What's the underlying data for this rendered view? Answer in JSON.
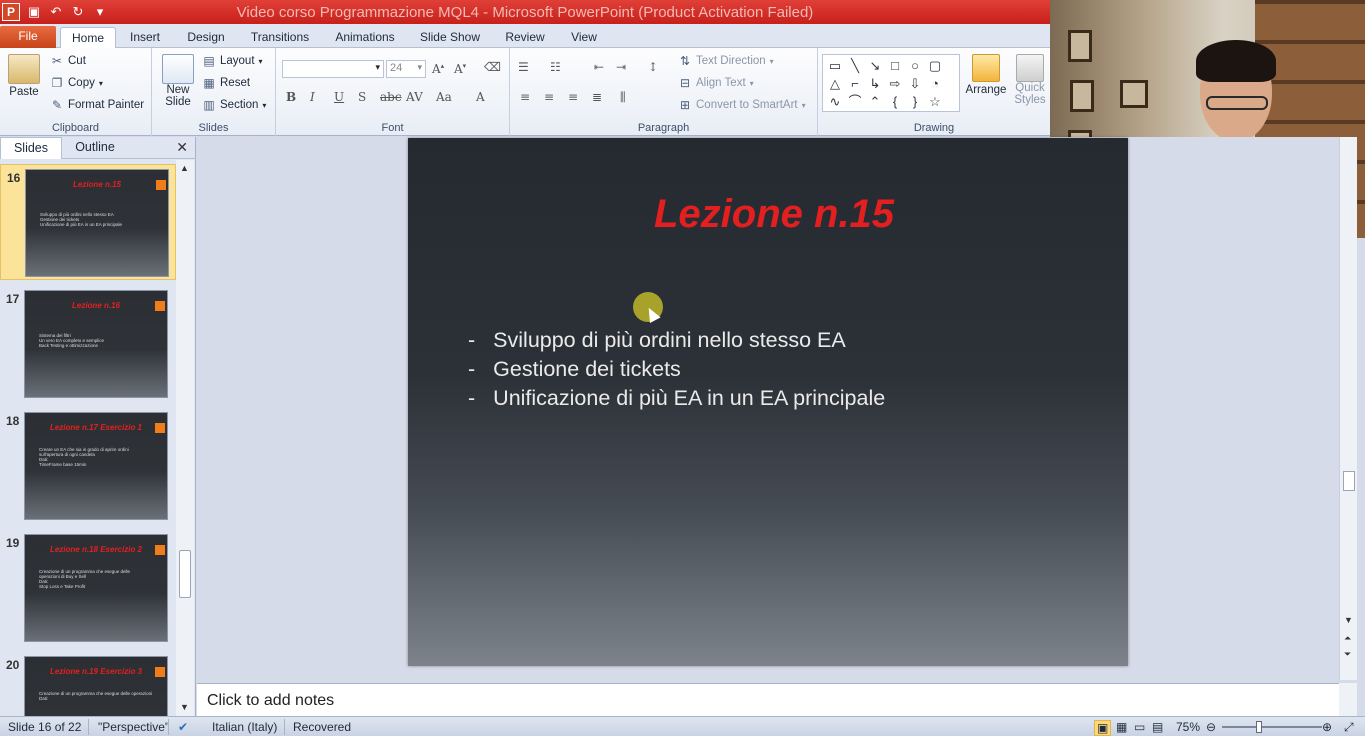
{
  "window": {
    "title": "Video corso Programmazione MQL4  -  Microsoft PowerPoint (Product Activation Failed)"
  },
  "tabs": [
    "File",
    "Home",
    "Insert",
    "Design",
    "Transitions",
    "Animations",
    "Slide Show",
    "Review",
    "View"
  ],
  "ribbon": {
    "clipboard": {
      "paste": "Paste",
      "cut": "Cut",
      "copy": "Copy",
      "format_painter": "Format Painter",
      "label": "Clipboard"
    },
    "slides": {
      "new_slide_1": "New",
      "new_slide_2": "Slide",
      "layout": "Layout",
      "reset": "Reset",
      "section": "Section",
      "label": "Slides"
    },
    "font": {
      "name": "",
      "size": "24",
      "label": "Font"
    },
    "paragraph": {
      "text_direction": "Text Direction",
      "align_text": "Align Text",
      "convert_smartart": "Convert to SmartArt",
      "label": "Paragraph"
    },
    "drawing": {
      "arrange": "Arrange",
      "quick_styles_1": "Quick",
      "quick_styles_2": "Styles",
      "label": "Drawing"
    }
  },
  "left_panel": {
    "tab_slides": "Slides",
    "tab_outline": "Outline",
    "thumbnails": [
      {
        "num": "16",
        "title": "Lezione n.15",
        "bullets": [
          "Sviluppo di più ordini nello stesso EA",
          "Gestione dei tickets",
          "Unificazione di più EA in un EA principale"
        ],
        "selected": true
      },
      {
        "num": "17",
        "title": "Lezione n.16",
        "bullets": [
          "Sistema dei filtri",
          "Un vero EA completo e semplice",
          "Back Testing e ottimizzazione"
        ],
        "selected": false
      },
      {
        "num": "18",
        "title": "Lezione n.17 Esercizio 1",
        "bullets": [
          "Creare un EA che sia in grado di aprire ordini",
          "sull'apertura di ogni candela",
          "Dati:",
          "TimeFrame base 15min"
        ],
        "selected": false
      },
      {
        "num": "19",
        "title": "Lezione n.18 Esercizio 2",
        "bullets": [
          "Creazione di un programma che esegue delle",
          "operazioni di Buy e Sell",
          "Dati:",
          "Stop Loss e Take Profit"
        ],
        "selected": false
      },
      {
        "num": "20",
        "title": "Lezione n.19 Esercizio 3",
        "bullets": [
          "Creazione di un programma che esegue delle operazioni",
          "Dati:"
        ],
        "selected": false
      }
    ]
  },
  "slide": {
    "title": "Lezione n.15",
    "bullets": [
      "Sviluppo di più ordini nello stesso EA",
      "Gestione dei tickets",
      "Unificazione di più EA in un EA principale"
    ]
  },
  "notes": {
    "placeholder": "Click to add notes"
  },
  "status": {
    "slide_info": "Slide 16 of 22",
    "theme": "\"Perspective\"",
    "language": "Italian (Italy)",
    "recovered": "Recovered",
    "zoom": "75%"
  },
  "colors": {
    "title_red": "#e41f1f",
    "file_tab": "#d2522a",
    "accent_orange": "#f07d1a"
  }
}
